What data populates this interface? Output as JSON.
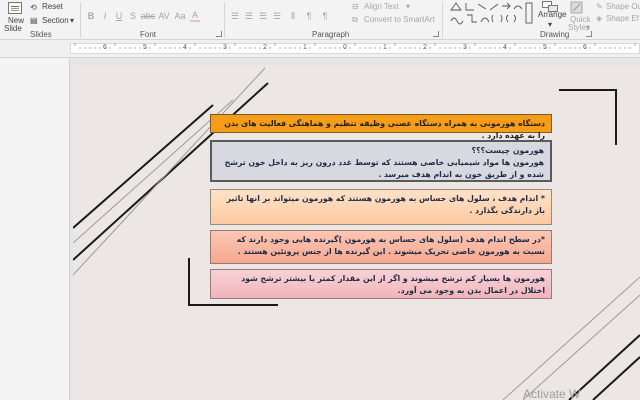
{
  "ribbon": {
    "slides_group": {
      "new_slide_label": "New",
      "new_slide_sub": "Slide",
      "reset_label": "Reset",
      "section_label": "Section",
      "group_label": "Slides"
    },
    "font_group": {
      "group_label": "Font",
      "bold": "B",
      "italic": "I",
      "underline": "U",
      "strike": "S",
      "font_color": "A",
      "highlight": "A",
      "shadow": "A"
    },
    "paragraph_group": {
      "align_text": "Align Text",
      "convert_smartart": "Convert to SmartArt",
      "group_label": "Paragraph"
    },
    "drawing_group": {
      "arrange_label": "Arrange",
      "quick_styles_line1": "Quick",
      "quick_styles_line2": "Styles",
      "shape_outline": "Shape Ou",
      "shape_effects": "Shape Ef",
      "group_label": "Drawing"
    }
  },
  "ruler": {
    "numbers": [
      "6",
      "5",
      "4",
      "3",
      "2",
      "1",
      "0",
      "1",
      "2",
      "3",
      "4",
      "5",
      "6"
    ]
  },
  "slide": {
    "box1": "دستگاه هورمونی به همراه دستگاه عصبی وظیفه تنظیم و هماهنگی فعالیت های بدن را به عهده دارد .",
    "box2_title": "هورمون چیست؟؟؟",
    "box2_body": "هورمون ها مواد شیمیایی خاصی هستند که توسط غدد درون ریز به داخل خون ترشح شده و از طریق خون به اندام هدف میرسد .",
    "box3": "* اندام هدف ، سلول های حساس به هورمون هستند که هورمون میتواند بر انها تاثیر باز دارندگی بگذارد .",
    "box4": "*در سطح اندام هدف (سلول های حساس به هورمون )گیرنده هایی وجود دارند که نسبت به هورمون خاصی تحریک میشوند . این گیرنده ها از جنس پروتئین هستند .",
    "box5": "هورمون ها بسیار کم ترشح میشوند و اگر از این مقدار کمتر یا بیشتر ترشح شود اختلال در اعمال بدن به وجود می آورد."
  },
  "watermark": "Activate W",
  "colors": {
    "box1": "#f59d1a",
    "box2": "#d8d9e0",
    "box3": "#fcd3b4",
    "box4": "#f8b7a2",
    "box5": "#f4c3c8",
    "slide_bg": "#ece7e4"
  }
}
